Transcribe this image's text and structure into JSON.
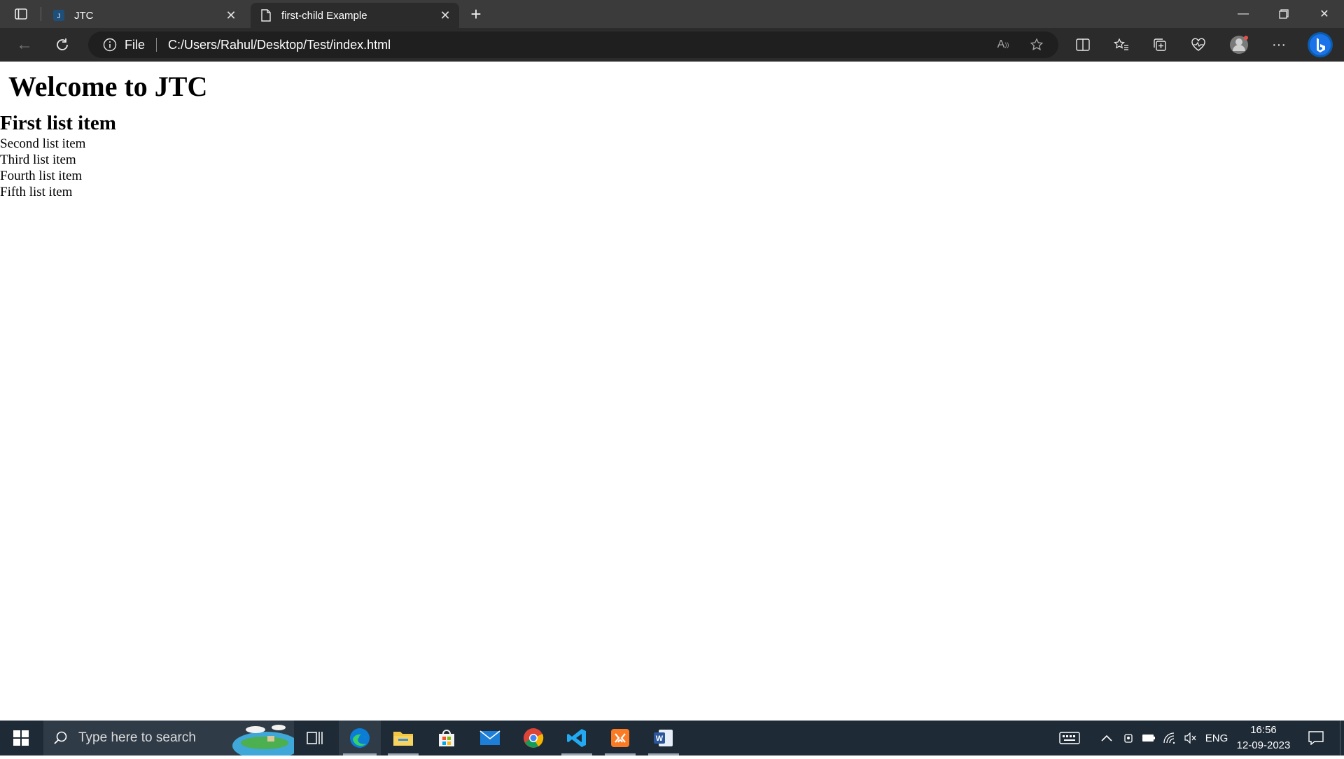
{
  "browser": {
    "tabs": [
      {
        "title": "JTC",
        "icon": "jtc-favicon-icon"
      },
      {
        "title": "first-child Example",
        "icon": "page-icon"
      }
    ],
    "address": {
      "scheme_label": "File",
      "url": "C:/Users/Rahul/Desktop/Test/index.html"
    }
  },
  "page": {
    "heading": "Welcome to JTC",
    "first_item": "First list item",
    "items": [
      "Second list item",
      "Third list item",
      "Fourth list item",
      "Fifth list item"
    ]
  },
  "taskbar": {
    "search_placeholder": "Type here to search",
    "language": "ENG",
    "time": "16:56",
    "date": "12-09-2023"
  },
  "colors": {
    "tabbar": "#3b3b3b",
    "toolbar": "#2b2b2b",
    "taskbar": "#1e2a36",
    "edge_accent": "#1a73e8"
  }
}
